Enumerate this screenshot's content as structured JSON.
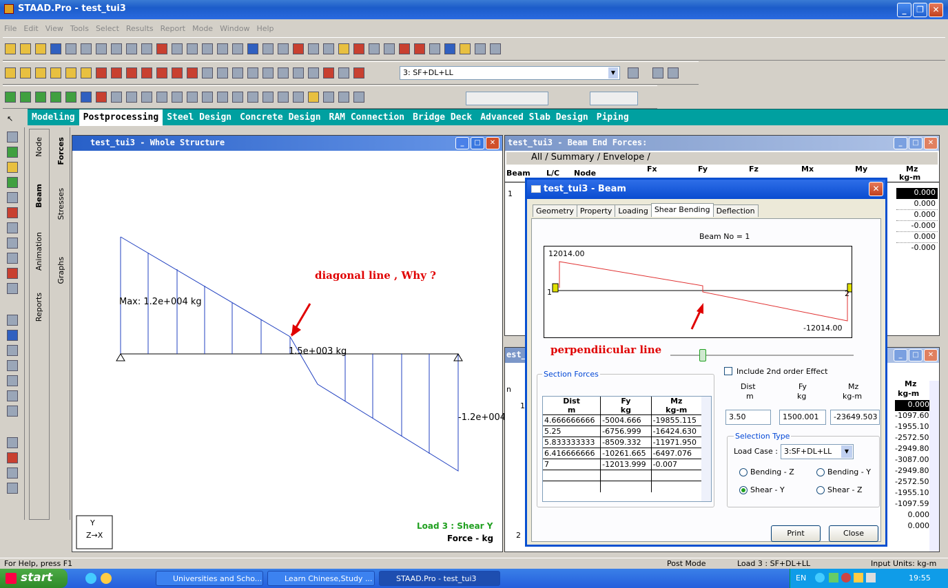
{
  "window": {
    "title": "STAAD.Pro - test_tui3",
    "min": "_",
    "restore": "❐",
    "close": "✕"
  },
  "menu": [
    "File",
    "Edit",
    "View",
    "Tools",
    "Select",
    "Results",
    "Report",
    "Mode",
    "Window",
    "Help"
  ],
  "toolbar": {
    "load_case": "3: SF+DL+LL"
  },
  "modes": [
    "Modeling",
    "Postprocessing",
    "Steel Design",
    "Concrete Design",
    "RAM Connection",
    "Bridge Deck",
    "Advanced Slab Design",
    "Piping"
  ],
  "side_tabs": {
    "node": "Node",
    "beam": "Beam",
    "reports": "Reports",
    "forces": "Forces",
    "stresses": "Stresses",
    "animation": "Animation",
    "graphs": "Graphs"
  },
  "structure_window": {
    "title": "test_tui3 - Whole Structure",
    "max_label": "Max: 1.2e+004 kg",
    "mid_label": "1.5e+003 kg",
    "end_label": "-1.2e+004",
    "load_text": "Load 3 : Shear Y",
    "force_text": "Force - kg",
    "annotation": "diagonal  line , Why ?",
    "axis_y": "Y",
    "axis_zx": "Z→X"
  },
  "end_forces_window": {
    "title": "test_tui3 - Beam End Forces:",
    "tabs": "All / Summary / Envelope /",
    "headers": [
      "Beam",
      "L/C",
      "Node",
      "Fx",
      "Fy",
      "Fz",
      "Mx",
      "My",
      "Mz"
    ],
    "units": "kg-m",
    "beam_row": "1",
    "mz_values": [
      "0.000",
      "0.000",
      "0.000",
      "-0.000",
      "0.000",
      "-0.000"
    ]
  },
  "lower_window": {
    "title_fragment": "est_t",
    "mz_header": "Mz",
    "mz_unit": "kg-m",
    "row_n": "n",
    "row_1": "1",
    "row_2": "2",
    "values": [
      "0.000",
      "-1097.600",
      "-1955.100",
      "-2572.500",
      "-2949.800",
      "-3087.000",
      "-2949.800",
      "-2572.500",
      "-1955.100",
      "-1097.599",
      "0.000",
      "0.000"
    ]
  },
  "dialog": {
    "title": "test_tui3 - Beam",
    "tabs": [
      "Geometry",
      "Property",
      "Loading",
      "Shear Bending",
      "Deflection"
    ],
    "beam_no": "Beam No = 1",
    "top_value": "12014.00",
    "bottom_value": "-12014.00",
    "node1": "1",
    "node2": "2",
    "annotation": "perpendiicular  line",
    "section_forces_label": "Section Forces",
    "table_headers": [
      [
        "Dist",
        "m"
      ],
      [
        "Fy",
        "kg"
      ],
      [
        "Mz",
        "kg-m"
      ]
    ],
    "rows": [
      [
        "4.666666666",
        "-5004.666",
        "-19855.115"
      ],
      [
        "5.25",
        "-6756.999",
        "-16424.630"
      ],
      [
        "5.833333333",
        "-8509.332",
        "-11971.950"
      ],
      [
        "6.416666666",
        "-10261.665",
        "-6497.076"
      ],
      [
        "7",
        "-12013.999",
        "-0.007"
      ]
    ],
    "include_2nd": "Include 2nd order Effect",
    "dist_label": "Dist",
    "dist_unit": "m",
    "fy_label": "Fy",
    "fy_unit": "kg",
    "mz_label": "Mz",
    "mz_unit": "kg-m",
    "dist_value": "3.50",
    "fy_value": "1500.001",
    "mz_value": "-23649.503",
    "selection_type": "Selection Type",
    "load_case_label": "Load Case :",
    "load_case_value": "3:SF+DL+LL",
    "radios": [
      "Bending - Z",
      "Bending - Y",
      "Shear - Y",
      "Shear - Z"
    ],
    "selected_radio": "Shear - Y",
    "print": "Print",
    "close": "Close"
  },
  "status": {
    "help": "For Help, press F1",
    "mode": "Post Mode",
    "load": "Load 3 : SF+DL+LL",
    "units": "Input Units:  kg-m"
  },
  "taskbar": {
    "start": "start",
    "tasks": [
      "Universities and Scho...",
      "Learn Chinese,Study ...",
      "STAAD.Pro - test_tui3"
    ],
    "lang": "EN",
    "time": "19:55"
  },
  "colors": {
    "diagram": "#2040c0",
    "annotation": "#e00000",
    "teal": "#00a0a0",
    "dialog_diagram": "#e03030"
  }
}
